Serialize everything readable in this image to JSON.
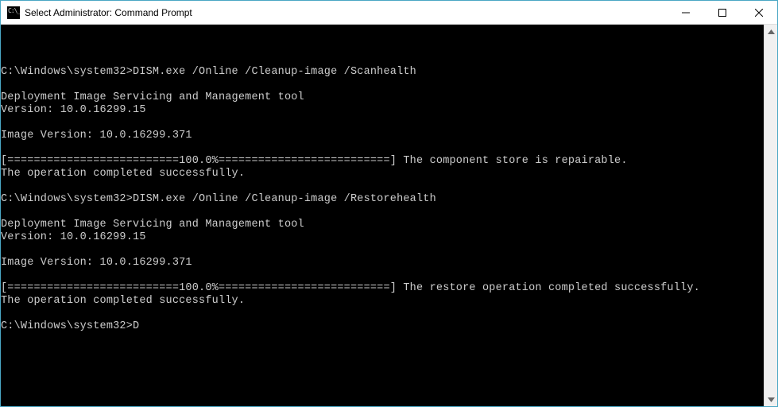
{
  "window": {
    "title": "Select Administrator: Command Prompt"
  },
  "terminal": {
    "lines": [
      "",
      "",
      "",
      "C:\\Windows\\system32>DISM.exe /Online /Cleanup-image /Scanhealth",
      "",
      "Deployment Image Servicing and Management tool",
      "Version: 10.0.16299.15",
      "",
      "Image Version: 10.0.16299.371",
      "",
      "[==========================100.0%==========================] The component store is repairable.",
      "The operation completed successfully.",
      "",
      "C:\\Windows\\system32>DISM.exe /Online /Cleanup-image /Restorehealth",
      "",
      "Deployment Image Servicing and Management tool",
      "Version: 10.0.16299.15",
      "",
      "Image Version: 10.0.16299.371",
      "",
      "[==========================100.0%==========================] The restore operation completed successfully.",
      "The operation completed successfully.",
      "",
      "C:\\Windows\\system32>D"
    ]
  }
}
